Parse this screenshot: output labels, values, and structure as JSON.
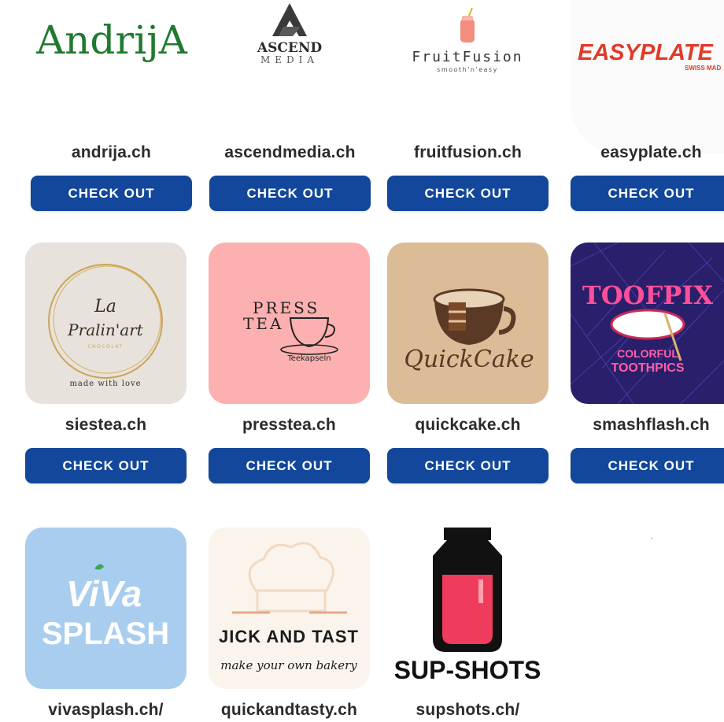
{
  "brand_colors": {
    "button_bg": "#12479b",
    "button_text": "#ffffff",
    "domain_text": "#2b2b2b"
  },
  "cards": [
    {
      "domain": "andrija.ch",
      "button": "CHECK OUT",
      "logo": {
        "icon": "andrija-logo",
        "text": "AndrijA"
      }
    },
    {
      "domain": "ascendmedia.ch",
      "button": "CHECK OUT",
      "logo": {
        "icon": "ascend-media-logo",
        "line1": "ASCEND",
        "line2": "MEDIA"
      }
    },
    {
      "domain": "fruitfusion.ch",
      "button": "CHECK OUT",
      "logo": {
        "icon": "fruitfusion-logo",
        "line1": "FruitFusion",
        "line2": "smooth'n'easy"
      }
    },
    {
      "domain": "easyplate.ch",
      "button": "CHECK OUT",
      "logo": {
        "icon": "easyplate-logo",
        "line1": "EASYPLATE",
        "line2": "SWISS MAD"
      }
    },
    {
      "domain": "siestea.ch",
      "button": "CHECK OUT",
      "logo": {
        "icon": "la-pralinart-logo",
        "line1": "La",
        "line2": "Pralin'art",
        "line3": "CHOCOLAT",
        "line4": "made with love"
      }
    },
    {
      "domain": "presstea.ch",
      "button": "CHECK OUT",
      "logo": {
        "icon": "press-tea-logo",
        "line1": "PRESS",
        "line2": "TEA",
        "line3": "Teekapseln"
      }
    },
    {
      "domain": "quickcake.ch",
      "button": "CHECK OUT",
      "logo": {
        "icon": "quickcake-logo",
        "line1": "QuickCake"
      }
    },
    {
      "domain": "smashflash.ch",
      "button": "CHECK OUT",
      "logo": {
        "icon": "toofpix-logo",
        "line1": "TOOFPIX",
        "line2": "COLORFUL",
        "line3": "TOOTHPICS"
      }
    },
    {
      "domain": "vivasplash.ch/",
      "button": "",
      "logo": {
        "icon": "vivasplash-logo",
        "line1": "ViVa",
        "line2": "SPLASH"
      }
    },
    {
      "domain": "quickandtasty.ch",
      "button": "",
      "logo": {
        "icon": "quick-and-tasty-logo",
        "line1": "JICK AND TAST",
        "line2": "make your own bakery"
      }
    },
    {
      "domain": "supshots.ch/",
      "button": "",
      "logo": {
        "icon": "supshots-logo",
        "line1": "SUP-SHOTS"
      }
    }
  ]
}
